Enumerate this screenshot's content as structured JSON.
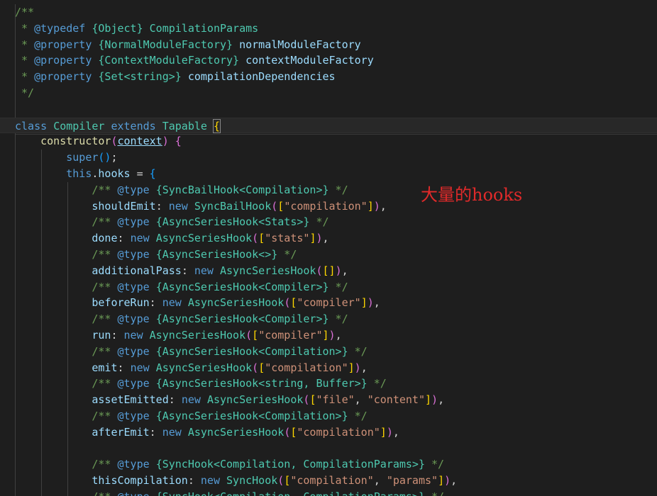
{
  "annotation": "大量的hooks",
  "code": {
    "doc_open": "/**",
    "typedef_tag": "@typedef",
    "typedef_type": "{Object}",
    "typedef_name": "CompilationParams",
    "property_tag": "@property",
    "prop1_type": "{NormalModuleFactory}",
    "prop1_name": "normalModuleFactory",
    "prop2_type": "{ContextModuleFactory}",
    "prop2_name": "contextModuleFactory",
    "prop3_type": "{Set<string>}",
    "prop3_name": "compilationDependencies",
    "doc_close": "*/",
    "kw_class": "class",
    "class_name": "Compiler",
    "kw_extends": "extends",
    "base_class": "Tapable",
    "ctor": "constructor",
    "ctor_param": "context",
    "kw_super": "super",
    "kw_this": "this",
    "hooks_prop": "hooks",
    "kw_new": "new",
    "jsdoc_open": "/**",
    "jsdoc_close": "*/",
    "type_tag": "@type",
    "hooks": [
      {
        "type": "{SyncBailHook<Compilation>}",
        "name": "shouldEmit",
        "ctor": "SyncBailHook",
        "args": [
          "\"compilation\""
        ]
      },
      {
        "type": "{AsyncSeriesHook<Stats>}",
        "name": "done",
        "ctor": "AsyncSeriesHook",
        "args": [
          "\"stats\""
        ]
      },
      {
        "type": "{AsyncSeriesHook<>}",
        "name": "additionalPass",
        "ctor": "AsyncSeriesHook",
        "args": []
      },
      {
        "type": "{AsyncSeriesHook<Compiler>}",
        "name": "beforeRun",
        "ctor": "AsyncSeriesHook",
        "args": [
          "\"compiler\""
        ]
      },
      {
        "type": "{AsyncSeriesHook<Compiler>}",
        "name": "run",
        "ctor": "AsyncSeriesHook",
        "args": [
          "\"compiler\""
        ]
      },
      {
        "type": "{AsyncSeriesHook<Compilation>}",
        "name": "emit",
        "ctor": "AsyncSeriesHook",
        "args": [
          "\"compilation\""
        ]
      },
      {
        "type": "{AsyncSeriesHook<string, Buffer>}",
        "name": "assetEmitted",
        "ctor": "AsyncSeriesHook",
        "args": [
          "\"file\"",
          "\"content\""
        ]
      },
      {
        "type": "{AsyncSeriesHook<Compilation>}",
        "name": "afterEmit",
        "ctor": "AsyncSeriesHook",
        "args": [
          "\"compilation\""
        ]
      },
      {
        "type": "{SyncHook<Compilation, CompilationParams>}",
        "name": "thisCompilation",
        "ctor": "SyncHook",
        "args": [
          "\"compilation\"",
          "\"params\""
        ]
      },
      {
        "type": "{SyncHook<Compilation, CompilationParams>}"
      }
    ]
  }
}
